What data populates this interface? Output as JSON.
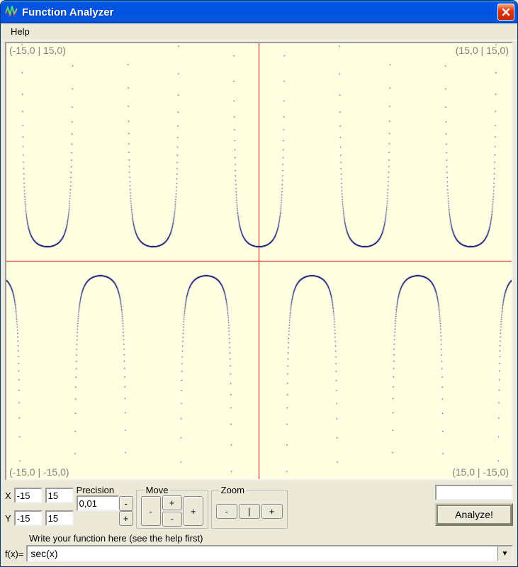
{
  "titlebar": {
    "title": "Function Analyzer"
  },
  "menubar": {
    "help": "Help"
  },
  "plot": {
    "corner_tl": "(-15,0 | 15,0)",
    "corner_tr": "(15,0 | 15,0)",
    "corner_bl": "(-15,0 | -15,0)",
    "corner_br": "(15,0 | -15,0)"
  },
  "chart_data": {
    "type": "line",
    "title": "",
    "function": "sec(x)",
    "xlim": [
      -15,
      15
    ],
    "ylim": [
      -15,
      15
    ],
    "precision": 0.01,
    "axis_color": "#d40000",
    "curve_color": "#000070",
    "background": "#ffffe1",
    "description": "y = sec(x) = 1/cos(x); vertical asymptotes at x = (pi/2) + k*pi; U-shaped branches above y=1 and inverted-U branches below y=-1"
  },
  "controls": {
    "x_label": "X",
    "y_label": "Y",
    "x_min": "-15",
    "x_max": "15",
    "y_min": "-15",
    "y_max": "15",
    "precision_label": "Precision",
    "precision": "0,01",
    "spin_minus": "-",
    "spin_plus": "+",
    "move_label": "Move",
    "move_up": "+",
    "move_down": "-",
    "move_left": "-",
    "move_right": "+",
    "zoom_label": "Zoom",
    "zoom_out": "-",
    "zoom_reset": "|",
    "zoom_in": "+",
    "analyze": "Analyze!",
    "small_field": ""
  },
  "bottom": {
    "hint": "Write your function here (see the help first)",
    "fx_label": "f(x)=",
    "fx_value": "sec(x)"
  }
}
